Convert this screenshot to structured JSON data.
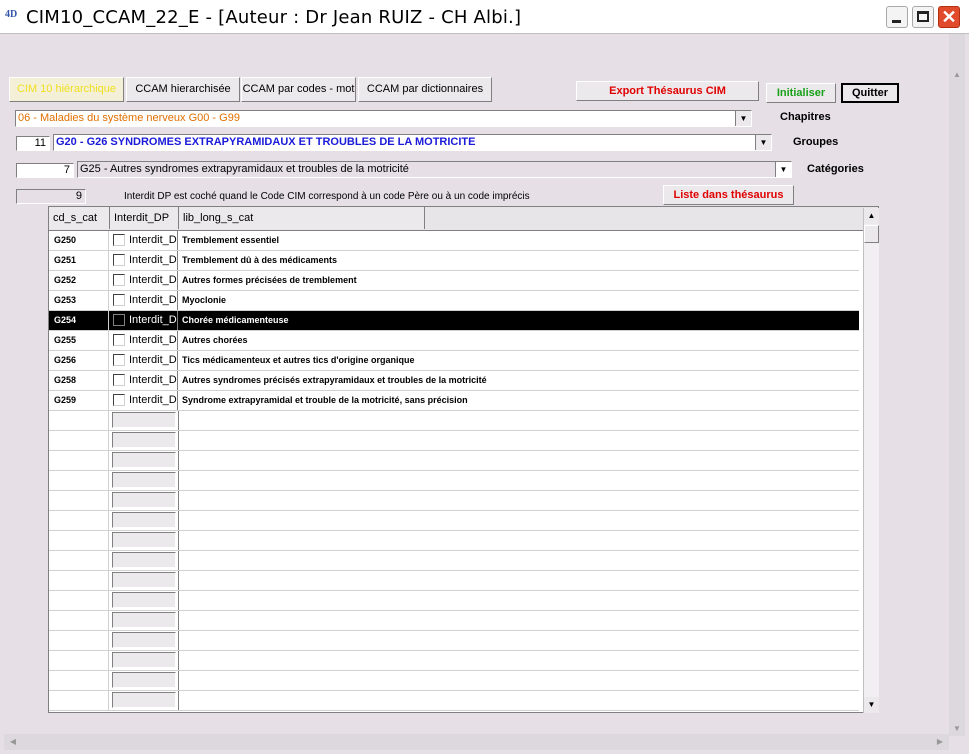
{
  "window": {
    "title": "CIM10_CCAM_22_E - [Auteur : Dr Jean RUIZ - CH Albi.]",
    "icon": "4D-icon"
  },
  "toolbar": {
    "tabs": [
      {
        "label": "CIM 10 hiérarchique",
        "active": true
      },
      {
        "label": "CCAM hierarchisée",
        "active": false
      },
      {
        "label": "CCAM par codes - mot",
        "active": false
      },
      {
        "label": "CCAM par dictionnaires",
        "active": false
      }
    ],
    "export_label": "Export Thésaurus CIM",
    "init_label": "Initialiser",
    "quit_label": "Quitter"
  },
  "filters": {
    "chapitre": {
      "value": "06 - Maladies du système nerveux G00   - G99",
      "label": "Chapitres",
      "color": "#e07000"
    },
    "groupe": {
      "number": "11",
      "value": "G20   - G26   SYNDROMES EXTRAPYRAMIDAUX ET TROUBLES DE LA MOTRICITE",
      "label": "Groupes",
      "color": "#1a1ad8"
    },
    "categorie": {
      "number": "7",
      "value": "G25   - Autres syndromes extrapyramidaux et troubles de la motricité",
      "label": "Catégories"
    },
    "count": "9",
    "note": "Interdit DP est coché quand le Code CIM correspond à un code Père ou à un code imprécis",
    "liste_label": "Liste dans thésaurus"
  },
  "grid": {
    "columns": [
      "cd_s_cat",
      "Interdit_DP",
      "lib_long_s_cat"
    ],
    "checkbox_label": "Interdit_D",
    "rows": [
      {
        "code": "G250",
        "lib": "Tremblement essentiel",
        "selected": false
      },
      {
        "code": "G251",
        "lib": "Tremblement dû à des médicaments",
        "selected": false
      },
      {
        "code": "G252",
        "lib": "Autres formes précisées de tremblement",
        "selected": false
      },
      {
        "code": "G253",
        "lib": "Myoclonie",
        "selected": false
      },
      {
        "code": "G254",
        "lib": "Chorée médicamenteuse",
        "selected": true
      },
      {
        "code": "G255",
        "lib": "Autres chorées",
        "selected": false
      },
      {
        "code": "G256",
        "lib": "Tics médicamenteux et autres tics d'origine organique",
        "selected": false
      },
      {
        "code": "G258",
        "lib": "Autres syndromes précisés extrapyramidaux et troubles de la motricité",
        "selected": false
      },
      {
        "code": "G259",
        "lib": "Syndrome extrapyramidal et trouble de la motricité, sans précision",
        "selected": false
      }
    ]
  }
}
